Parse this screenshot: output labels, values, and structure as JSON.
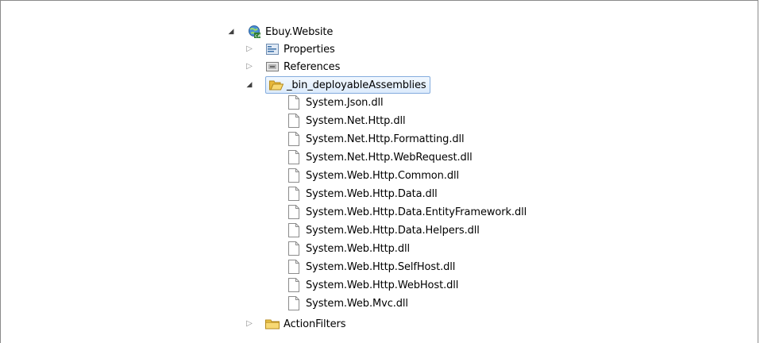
{
  "tree": {
    "root": {
      "label": "Ebuy.Website",
      "expanded": true,
      "icon": "web-project-icon"
    },
    "children": [
      {
        "label": "Properties",
        "expanded": false,
        "icon": "properties-icon"
      },
      {
        "label": "References",
        "expanded": false,
        "icon": "references-icon"
      },
      {
        "label": "_bin_deployableAssemblies",
        "expanded": true,
        "selected": true,
        "icon": "open-folder-icon",
        "files": [
          "System.Json.dll",
          "System.Net.Http.dll",
          "System.Net.Http.Formatting.dll",
          "System.Net.Http.WebRequest.dll",
          "System.Web.Http.Common.dll",
          "System.Web.Http.Data.dll",
          "System.Web.Http.Data.EntityFramework.dll",
          "System.Web.Http.Data.Helpers.dll",
          "System.Web.Http.dll",
          "System.Web.Http.SelfHost.dll",
          "System.Web.Http.WebHost.dll",
          "System.Web.Mvc.dll"
        ]
      },
      {
        "label": "ActionFilters",
        "expanded": false,
        "icon": "folder-icon"
      }
    ]
  },
  "colors": {
    "selection_border": "#84acdd",
    "selection_fill": "#dcebfc",
    "folder": "#f0c84a"
  }
}
